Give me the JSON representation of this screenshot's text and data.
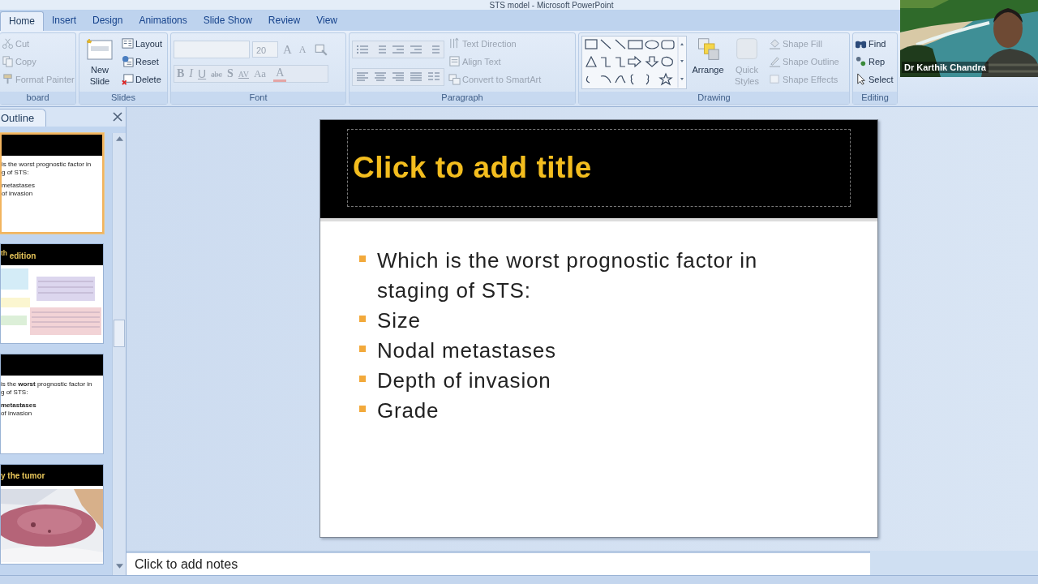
{
  "window": {
    "title": "STS model - Microsoft PowerPoint"
  },
  "tabs": [
    {
      "label": "Home",
      "selected": true
    },
    {
      "label": "Insert",
      "selected": false
    },
    {
      "label": "Design",
      "selected": false
    },
    {
      "label": "Animations",
      "selected": false
    },
    {
      "label": "Slide Show",
      "selected": false
    },
    {
      "label": "Review",
      "selected": false
    },
    {
      "label": "View",
      "selected": false
    }
  ],
  "ribbon": [
    {
      "kind": "clipboard",
      "label": "board",
      "commands": [
        {
          "label": "Cut",
          "disabled": true
        },
        {
          "label": "Copy",
          "disabled": true
        },
        {
          "label": "Format Painter",
          "disabled": true
        }
      ]
    },
    {
      "kind": "slides",
      "label": "Slides",
      "big": [
        {
          "label": "New Slide",
          "disabled": false
        }
      ],
      "commands": [
        {
          "label": "Layout",
          "disabled": false
        },
        {
          "label": "Reset",
          "disabled": false
        },
        {
          "label": "Delete",
          "disabled": false
        }
      ]
    },
    {
      "kind": "font",
      "label": "Font",
      "size": "20",
      "size_buttons": [
        {
          "label": "A",
          "disabled": true
        },
        {
          "label": "A",
          "disabled": true
        }
      ],
      "commands": [
        {
          "label": "B",
          "disabled": true
        },
        {
          "label": "I",
          "disabled": true
        },
        {
          "label": "U",
          "disabled": true
        },
        {
          "label": "abc",
          "disabled": true
        },
        {
          "label": "S",
          "disabled": true
        },
        {
          "label": "AV",
          "disabled": true
        },
        {
          "label": "Aa",
          "disabled": true
        },
        {
          "label": "A",
          "disabled": true
        }
      ]
    },
    {
      "kind": "paragraph",
      "label": "Paragraph",
      "commands": [
        {
          "label": "Text Direction",
          "disabled": true
        },
        {
          "label": "Align Text",
          "disabled": true
        },
        {
          "label": "Convert to SmartArt",
          "disabled": true
        }
      ]
    },
    {
      "kind": "drawing",
      "label": "Drawing",
      "big": [
        {
          "label": "Arrange",
          "disabled": false
        },
        {
          "label": "Quick Styles",
          "disabled": true
        }
      ],
      "commands": [
        {
          "label": "Shape Fill",
          "disabled": true
        },
        {
          "label": "Shape Outline",
          "disabled": true
        },
        {
          "label": "Shape Effects",
          "disabled": true
        }
      ]
    },
    {
      "kind": "editing",
      "label": "Editing",
      "commands": [
        {
          "label": "Find",
          "disabled": false
        },
        {
          "label": "Rep",
          "disabled": false
        },
        {
          "label": "Select",
          "disabled": false
        }
      ]
    }
  ],
  "pane": {
    "tab": "Outline"
  },
  "thumbnails": [
    {
      "kind": "text",
      "selected": true,
      "lines": [
        "is the worst prognostic  factor in",
        "g of STS:",
        "metastases",
        "of invasion"
      ]
    },
    {
      "kind": "table",
      "selected": false,
      "title": "$^{th}$ edition"
    },
    {
      "kind": "text",
      "selected": false,
      "lines": [
        "is the **worst** prognostic  factor in",
        "g of STS:",
        "**metastases**",
        "of invasion"
      ]
    },
    {
      "kind": "picture",
      "selected": false,
      "title": "y the tumor"
    }
  ],
  "slide": {
    "title": "Click to add title",
    "bullets": [
      "Which is the worst prognostic factor in staging of STS:",
      "Size",
      "Nodal metastases",
      "Depth of invasion",
      "Grade"
    ]
  },
  "notes": {
    "text": "Click to add notes"
  },
  "video": {
    "name": "Dr Karthik Chandra"
  }
}
